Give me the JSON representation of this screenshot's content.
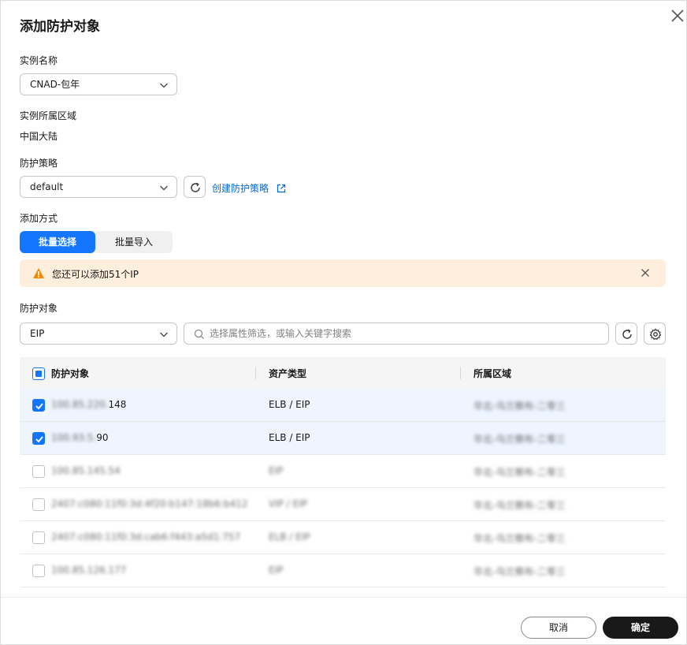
{
  "dialog": {
    "title": "添加防护对象"
  },
  "instance": {
    "label": "实例名称",
    "value": "CNAD-包年"
  },
  "region": {
    "label": "实例所属区域",
    "value": "中国大陆"
  },
  "policy": {
    "label": "防护策略",
    "value": "default",
    "create_link": "创建防护策略"
  },
  "add_method": {
    "label": "添加方式",
    "tabs": [
      "批量选择",
      "批量导入"
    ],
    "active": "批量选择"
  },
  "alert": {
    "message": "您还可以添加51个IP"
  },
  "target": {
    "label": "防护对象",
    "type_value": "EIP",
    "search_placeholder": "选择属性筛选，或输入关键字搜索"
  },
  "table": {
    "headers": [
      "防护对象",
      "资产类型",
      "所属区域"
    ],
    "rows": [
      {
        "ip_hidden": "100.85.220.",
        "ip_visible": "148",
        "type": "ELB / EIP",
        "region": "华北-乌兰察布-二零三",
        "checked": true,
        "type_blurred": false
      },
      {
        "ip_hidden": "100.93.5.",
        "ip_visible": "90",
        "type": "ELB / EIP",
        "region": "华北-乌兰察布-二零三",
        "checked": true,
        "type_blurred": false
      },
      {
        "ip_hidden": "100.85.145.54",
        "ip_visible": "",
        "type": "EIP",
        "region": "华北-乌兰察布-二零三",
        "checked": false,
        "type_blurred": true
      },
      {
        "ip_hidden": "2407:c080:11f0:3d:4f20:b147:18b6:b412",
        "ip_visible": "",
        "type": "VIP / EIP",
        "region": "华北-乌兰察布-二零三",
        "checked": false,
        "type_blurred": true
      },
      {
        "ip_hidden": "2407:c080:11f0:3d:cab6:f443:a5d1:757",
        "ip_visible": "",
        "type": "ELB / EIP",
        "region": "华北-乌兰察布-二零三",
        "checked": false,
        "type_blurred": true
      },
      {
        "ip_hidden": "100.85.126.177",
        "ip_visible": "",
        "type": "EIP",
        "region": "华北-乌兰察布-二零三",
        "checked": false,
        "type_blurred": true
      }
    ]
  },
  "footer": {
    "cancel": "取消",
    "ok": "确定"
  },
  "colors": {
    "primary": "#1476ff",
    "warning_bg": "#feefdc",
    "warning_icon": "#f08c00",
    "link": "#0069d9",
    "dark_button": "#191919"
  }
}
